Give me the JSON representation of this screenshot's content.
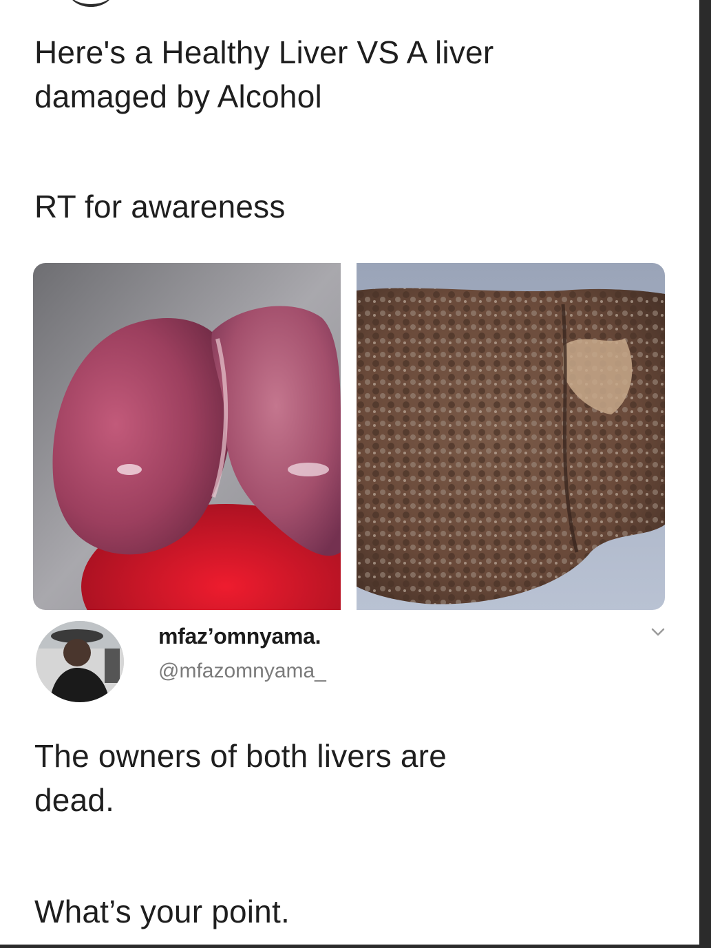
{
  "tweet": {
    "text_line_1": "Here's a Healthy Liver VS A liver\ndamaged by Alcohol",
    "text_line_2": "RT for awareness",
    "media": [
      {
        "icon": "healthy-liver-photo"
      },
      {
        "icon": "damaged-liver-photo"
      }
    ]
  },
  "reply": {
    "display_name": "mfaz’omnyama.",
    "handle": "@mfazomnyama_",
    "avatar_icon": "profile-photo",
    "menu_icon": "chevron-down-icon",
    "text_line_1": "The owners of both livers are\ndead.",
    "text_line_2": "What’s your point."
  },
  "colors": {
    "text": "#1e1e1e",
    "handle": "#7b7b7b",
    "background": "#ffffff",
    "edge": "#2b2b2b"
  }
}
